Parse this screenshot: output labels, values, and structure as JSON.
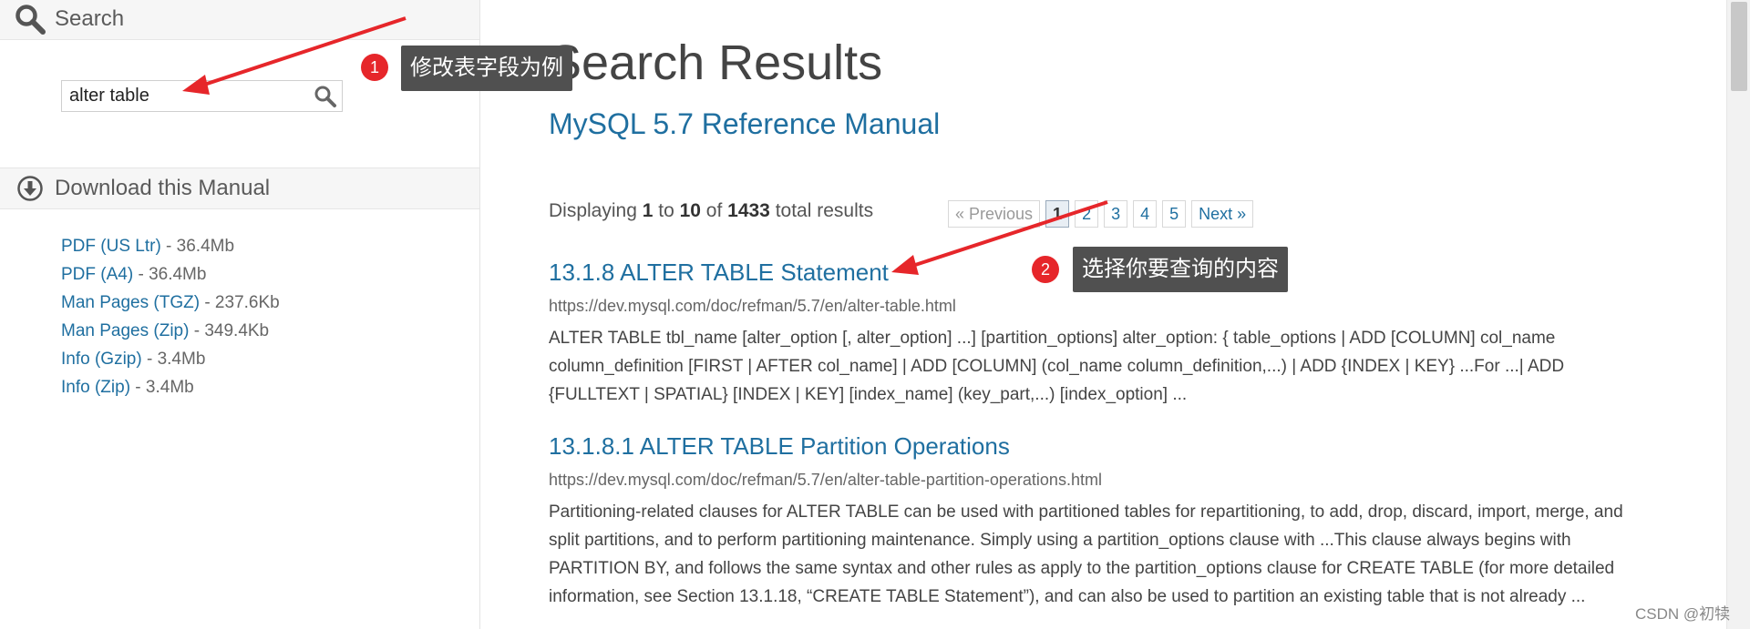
{
  "sidebar": {
    "search_label": "Search",
    "search_value": "alter table",
    "download_label": "Download this Manual",
    "downloads": [
      {
        "link": "PDF (US Ltr)",
        "size": " - 36.4Mb"
      },
      {
        "link": "PDF (A4)",
        "size": " - 36.4Mb"
      },
      {
        "link": "Man Pages (TGZ)",
        "size": " - 237.6Kb"
      },
      {
        "link": "Man Pages (Zip)",
        "size": " - 349.4Kb"
      },
      {
        "link": "Info (Gzip)",
        "size": " - 3.4Mb"
      },
      {
        "link": "Info (Zip)",
        "size": " - 3.4Mb"
      }
    ]
  },
  "main": {
    "page_title": "Search Results",
    "manual_title": "MySQL 5.7 Reference Manual",
    "summary": {
      "displaying": "Displaying ",
      "from": "1",
      "to_word": " to ",
      "to": "10",
      "of_word": " of ",
      "total": "1433",
      "suffix": " total results"
    },
    "pagination": {
      "previous": "« Previous",
      "pages": [
        "1",
        "2",
        "3",
        "4",
        "5"
      ],
      "current_page": "1",
      "next": "Next »"
    },
    "results": [
      {
        "title": "13.1.8 ALTER TABLE Statement",
        "url": "https://dev.mysql.com/doc/refman/5.7/en/alter-table.html",
        "snippet": "ALTER TABLE tbl_name [alter_option [, alter_option] ...] [partition_options] alter_option: { table_options | ADD [COLUMN] col_name column_definition [FIRST | AFTER col_name] | ADD [COLUMN] (col_name column_definition,...) | ADD {INDEX | KEY} ...For ...| ADD {FULLTEXT | SPATIAL} [INDEX | KEY] [index_name] (key_part,...) [index_option] ..."
      },
      {
        "title": "13.1.8.1 ALTER TABLE Partition Operations",
        "url": "https://dev.mysql.com/doc/refman/5.7/en/alter-table-partition-operations.html",
        "snippet": "Partitioning-related clauses for ALTER TABLE can be used with partitioned tables for repartitioning, to add, drop, discard, import, merge, and split partitions, and to perform partitioning maintenance. Simply using a partition_options clause with ...This clause always begins with PARTITION BY, and follows the same syntax and other rules as apply to the partition_options clause for CREATE TABLE (for more detailed information, see Section 13.1.18, “CREATE TABLE Statement”), and can also be used to partition an existing table that is not already ..."
      }
    ]
  },
  "annotations": [
    {
      "number": "1",
      "text": "修改表字段为例"
    },
    {
      "number": "2",
      "text": "选择你要查询的内容"
    }
  ],
  "watermark": "CSDN @初犊",
  "colors": {
    "link": "#1f6fa0",
    "annotation_red": "#e6262a",
    "annotation_box": "#505050"
  },
  "icons": {
    "search_header": "search-icon",
    "search_button": "search-icon",
    "download_header": "download-circle-icon"
  }
}
